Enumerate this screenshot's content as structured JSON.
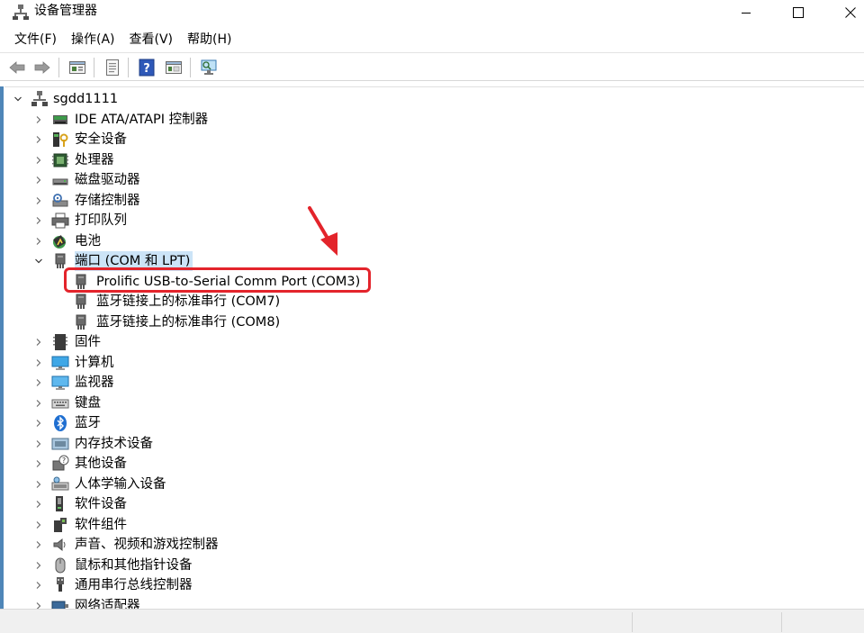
{
  "window": {
    "title": "设备管理器",
    "icon": "device-manager-icon"
  },
  "menu": [
    {
      "label": "文件(F)"
    },
    {
      "label": "操作(A)"
    },
    {
      "label": "查看(V)"
    },
    {
      "label": "帮助(H)"
    }
  ],
  "toolbar_icons": [
    "back-arrow-icon",
    "forward-arrow-icon",
    "properties-pane-icon",
    "document-icon",
    "help-icon",
    "show-hide-pane-icon",
    "monitor-scan-icon"
  ],
  "tree": {
    "root": "sgdd1111",
    "categories": [
      {
        "label": "IDE ATA/ATAPI 控制器",
        "icon": "ide-controller-icon"
      },
      {
        "label": "安全设备",
        "icon": "security-device-icon"
      },
      {
        "label": "处理器",
        "icon": "processor-icon"
      },
      {
        "label": "磁盘驱动器",
        "icon": "disk-drive-icon"
      },
      {
        "label": "存储控制器",
        "icon": "storage-controller-icon"
      },
      {
        "label": "打印队列",
        "icon": "printer-icon"
      },
      {
        "label": "电池",
        "icon": "battery-icon"
      },
      {
        "label": "端口 (COM 和 LPT)",
        "icon": "port-icon",
        "expanded": true,
        "children": [
          {
            "label": "Prolific USB-to-Serial Comm Port (COM3)"
          },
          {
            "label": "蓝牙链接上的标准串行 (COM7)"
          },
          {
            "label": "蓝牙链接上的标准串行 (COM8)"
          }
        ]
      },
      {
        "label": "固件",
        "icon": "firmware-icon"
      },
      {
        "label": "计算机",
        "icon": "computer-icon"
      },
      {
        "label": "监视器",
        "icon": "monitor-icon"
      },
      {
        "label": "键盘",
        "icon": "keyboard-icon"
      },
      {
        "label": "蓝牙",
        "icon": "bluetooth-icon"
      },
      {
        "label": "内存技术设备",
        "icon": "memory-device-icon"
      },
      {
        "label": "其他设备",
        "icon": "other-device-icon"
      },
      {
        "label": "人体学输入设备",
        "icon": "hid-icon"
      },
      {
        "label": "软件设备",
        "icon": "software-device-icon"
      },
      {
        "label": "软件组件",
        "icon": "software-component-icon"
      },
      {
        "label": "声音、视频和游戏控制器",
        "icon": "sound-icon"
      },
      {
        "label": "鼠标和其他指针设备",
        "icon": "mouse-icon"
      },
      {
        "label": "通用串行总线控制器",
        "icon": "usb-icon"
      },
      {
        "label": "网络适配器",
        "icon": "network-adapter-icon"
      }
    ]
  },
  "colors": {
    "highlight_box": "#e3242b",
    "selection": "#cce4f7",
    "arrow": "#e3242b"
  }
}
